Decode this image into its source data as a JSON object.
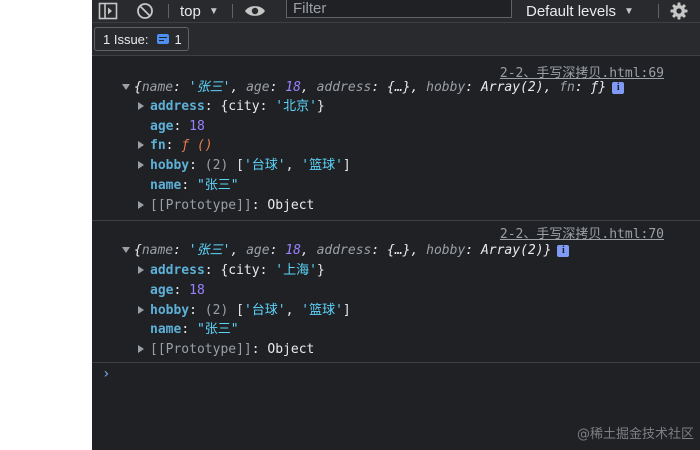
{
  "toolbar": {
    "context": "top",
    "filter_placeholder": "Filter",
    "levels_label": "Default levels"
  },
  "issues": {
    "label": "1 Issue:",
    "count": "1"
  },
  "messages": [
    {
      "source": "2-2、手写深拷贝.html:69",
      "summary": {
        "open": "{",
        "name_key": "name",
        "name_val": "'张三'",
        "age_key": "age",
        "age_val": "18",
        "address_key": "address",
        "address_val": "{…}",
        "hobby_key": "hobby",
        "hobby_val": "Array(2)",
        "fn_key": "fn",
        "fn_val": "ƒ",
        "close": "}"
      },
      "props": {
        "address_key": "address",
        "address_open": "{city: ",
        "address_city": "'北京'",
        "address_close": "}",
        "age_key": "age",
        "age_val": "18",
        "fn_key": "fn",
        "fn_val": "ƒ ()",
        "hobby_key": "hobby",
        "hobby_len": "(2)",
        "hobby_open": "[",
        "hobby_1": "'台球'",
        "hobby_2": "'篮球'",
        "hobby_close": "]",
        "name_key": "name",
        "name_val": "\"张三\"",
        "proto": "[[Prototype]]",
        "proto_val": "Object"
      }
    },
    {
      "source": "2-2、手写深拷贝.html:70",
      "summary": {
        "open": "{",
        "name_key": "name",
        "name_val": "'张三'",
        "age_key": "age",
        "age_val": "18",
        "address_key": "address",
        "address_val": "{…}",
        "hobby_key": "hobby",
        "hobby_val": "Array(2)",
        "close": "}"
      },
      "props": {
        "address_key": "address",
        "address_open": "{city: ",
        "address_city": "'上海'",
        "address_close": "}",
        "age_key": "age",
        "age_val": "18",
        "hobby_key": "hobby",
        "hobby_len": "(2)",
        "hobby_open": "[",
        "hobby_1": "'台球'",
        "hobby_2": "'篮球'",
        "hobby_close": "]",
        "name_key": "name",
        "name_val": "\"张三\"",
        "proto": "[[Prototype]]",
        "proto_val": "Object"
      }
    }
  ],
  "prompt_symbol": "›",
  "watermark": "@稀土掘金技术社区",
  "colors": {
    "background": "#202124",
    "toolbar": "#292a2d",
    "property_key": "#5db0d7",
    "string": "#5cd5fb",
    "number": "#9980ff",
    "function": "#e97c4b"
  },
  "icons": [
    "sidebar-toggle-icon",
    "clear-console-icon",
    "eye-icon",
    "gear-icon",
    "issue-icon",
    "info-icon"
  ]
}
